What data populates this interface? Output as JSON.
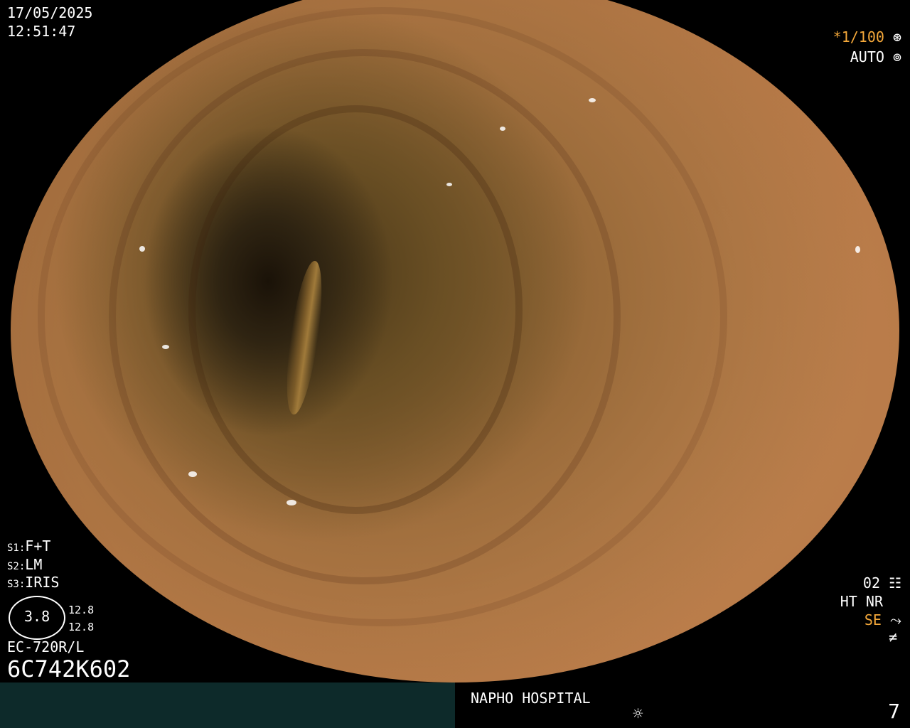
{
  "overlay": {
    "date": "17/05/2025",
    "time": "12:51:47",
    "shutter": "*1/100",
    "shutter_icon": "aperture-icon",
    "auto": "AUTO",
    "auto_icon": "iris-icon",
    "s1_label": "S1:",
    "s1_value": "F+T",
    "s2_label": "S2:",
    "s2_value": "LM",
    "s3_label": "S3:",
    "s3_value": "IRIS",
    "gauge_value": "3.8",
    "gauge_top": "12.8",
    "gauge_bottom": "12.8",
    "model": "EC-720R/L",
    "serial": "6C742K602",
    "mode_code": "02",
    "ht": "HT",
    "nr": "NR",
    "se": "SE",
    "hospital": "NAPHO HOSPITAL",
    "counter": "7"
  },
  "colors": {
    "orange": "#f4a83a",
    "footer_teal": "#0d2a2a"
  }
}
